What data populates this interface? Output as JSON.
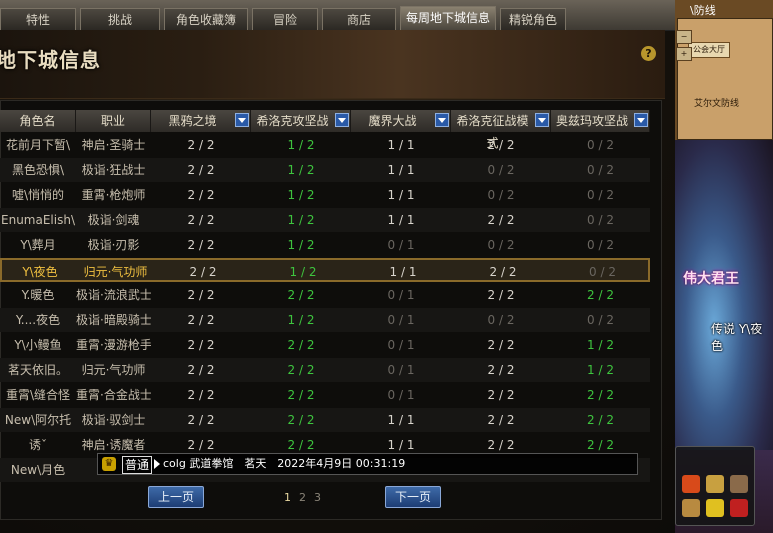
{
  "tabs": [
    {
      "label": "特性"
    },
    {
      "label": "挑战"
    },
    {
      "label": "角色收藏簿"
    },
    {
      "label": "冒险"
    },
    {
      "label": "商店"
    },
    {
      "label": "每周地下城信息",
      "active": true
    },
    {
      "label": "精锐角色"
    }
  ],
  "title": "地下城信息",
  "help_label": "?",
  "columns": [
    "角色名",
    "职业",
    "黑鸦之境",
    "希洛克攻坚战",
    "魔界大战",
    "希洛克征战模式",
    "奥兹玛攻坚战"
  ],
  "rows": [
    {
      "name": "花前月下暂\\",
      "job": "神启·圣骑士",
      "vals": [
        "2 / 2",
        "1 / 2",
        "1 / 1",
        "2 / 2",
        "0 / 2"
      ],
      "colors": [
        "white",
        "green",
        "white",
        "white",
        "gray"
      ]
    },
    {
      "name": "黑色恐惧\\",
      "job": "极诣·狂战士",
      "vals": [
        "2 / 2",
        "1 / 2",
        "1 / 1",
        "0 / 2",
        "0 / 2"
      ],
      "colors": [
        "white",
        "green",
        "white",
        "gray",
        "gray"
      ]
    },
    {
      "name": "噓\\悄悄的",
      "job": "重霄·枪炮师",
      "vals": [
        "2 / 2",
        "1 / 2",
        "1 / 1",
        "0 / 2",
        "0 / 2"
      ],
      "colors": [
        "white",
        "green",
        "white",
        "gray",
        "gray"
      ]
    },
    {
      "name": "EnumaElish\\",
      "job": "极诣·剑魂",
      "vals": [
        "2 / 2",
        "1 / 2",
        "1 / 1",
        "2 / 2",
        "0 / 2"
      ],
      "colors": [
        "white",
        "green",
        "white",
        "white",
        "gray"
      ]
    },
    {
      "name": "Y\\葬月",
      "job": "极诣·刃影",
      "vals": [
        "2 / 2",
        "1 / 2",
        "0 / 1",
        "0 / 2",
        "0 / 2"
      ],
      "colors": [
        "white",
        "green",
        "gray",
        "gray",
        "gray"
      ]
    },
    {
      "name": "Y\\夜色",
      "job": "归元·气功师",
      "vals": [
        "2 / 2",
        "1 / 2",
        "1 / 1",
        "2 / 2",
        "0 / 2"
      ],
      "colors": [
        "white",
        "green",
        "white",
        "white",
        "gray"
      ]
    },
    {
      "name": "Y.暖色",
      "job": "极诣·流浪武士",
      "vals": [
        "2 / 2",
        "2 / 2",
        "0 / 1",
        "2 / 2",
        "2 / 2"
      ],
      "colors": [
        "white",
        "green",
        "gray",
        "white",
        "green"
      ]
    },
    {
      "name": "Y....夜色",
      "job": "极诣·暗殿骑士",
      "vals": [
        "2 / 2",
        "1 / 2",
        "0 / 1",
        "0 / 2",
        "0 / 2"
      ],
      "colors": [
        "white",
        "green",
        "gray",
        "gray",
        "gray"
      ]
    },
    {
      "name": "Y\\小鳗鱼",
      "job": "重霄·漫游枪手",
      "vals": [
        "2 / 2",
        "2 / 2",
        "0 / 1",
        "2 / 2",
        "1 / 2"
      ],
      "colors": [
        "white",
        "green",
        "gray",
        "white",
        "green"
      ]
    },
    {
      "name": "茗天依旧。",
      "job": "归元·气功师",
      "vals": [
        "2 / 2",
        "2 / 2",
        "0 / 1",
        "2 / 2",
        "1 / 2"
      ],
      "colors": [
        "white",
        "green",
        "gray",
        "white",
        "green"
      ]
    },
    {
      "name": "重霄\\缝合怪",
      "job": "重霄·合金战士",
      "vals": [
        "2 / 2",
        "2 / 2",
        "0 / 1",
        "2 / 2",
        "2 / 2"
      ],
      "colors": [
        "white",
        "green",
        "gray",
        "white",
        "green"
      ]
    },
    {
      "name": "New\\阿尔托",
      "job": "极诣·驭剑士",
      "vals": [
        "2 / 2",
        "2 / 2",
        "1 / 1",
        "2 / 2",
        "2 / 2"
      ],
      "colors": [
        "white",
        "green",
        "white",
        "white",
        "green"
      ]
    },
    {
      "name": "诱ˇ",
      "job": "神启·诱魔者",
      "vals": [
        "2 / 2",
        "2 / 2",
        "1 / 1",
        "2 / 2",
        "2 / 2"
      ],
      "colors": [
        "white",
        "green",
        "white",
        "white",
        "green"
      ]
    },
    {
      "name": "New\\月色",
      "job": "",
      "vals": [
        "",
        "",
        "",
        "",
        ""
      ],
      "colors": [
        "white",
        "white",
        "white",
        "white",
        "white"
      ]
    }
  ],
  "selected_row": 5,
  "pagination": {
    "prev": "上一页",
    "next": "下一页",
    "pages": [
      "1",
      "2",
      "3"
    ],
    "current": 0
  },
  "chat": {
    "icon": "crown-icon",
    "channel": "普通",
    "message": "colg 武道拳馆　茗天　2022年4月9日 00:31:19"
  },
  "right_panel": {
    "top_text": "\\防线",
    "guild_button": "公会大厅",
    "map_label": "艾尔文防线",
    "boss_text": "伟大君王",
    "player_label": "传说 Y\\夜色"
  }
}
